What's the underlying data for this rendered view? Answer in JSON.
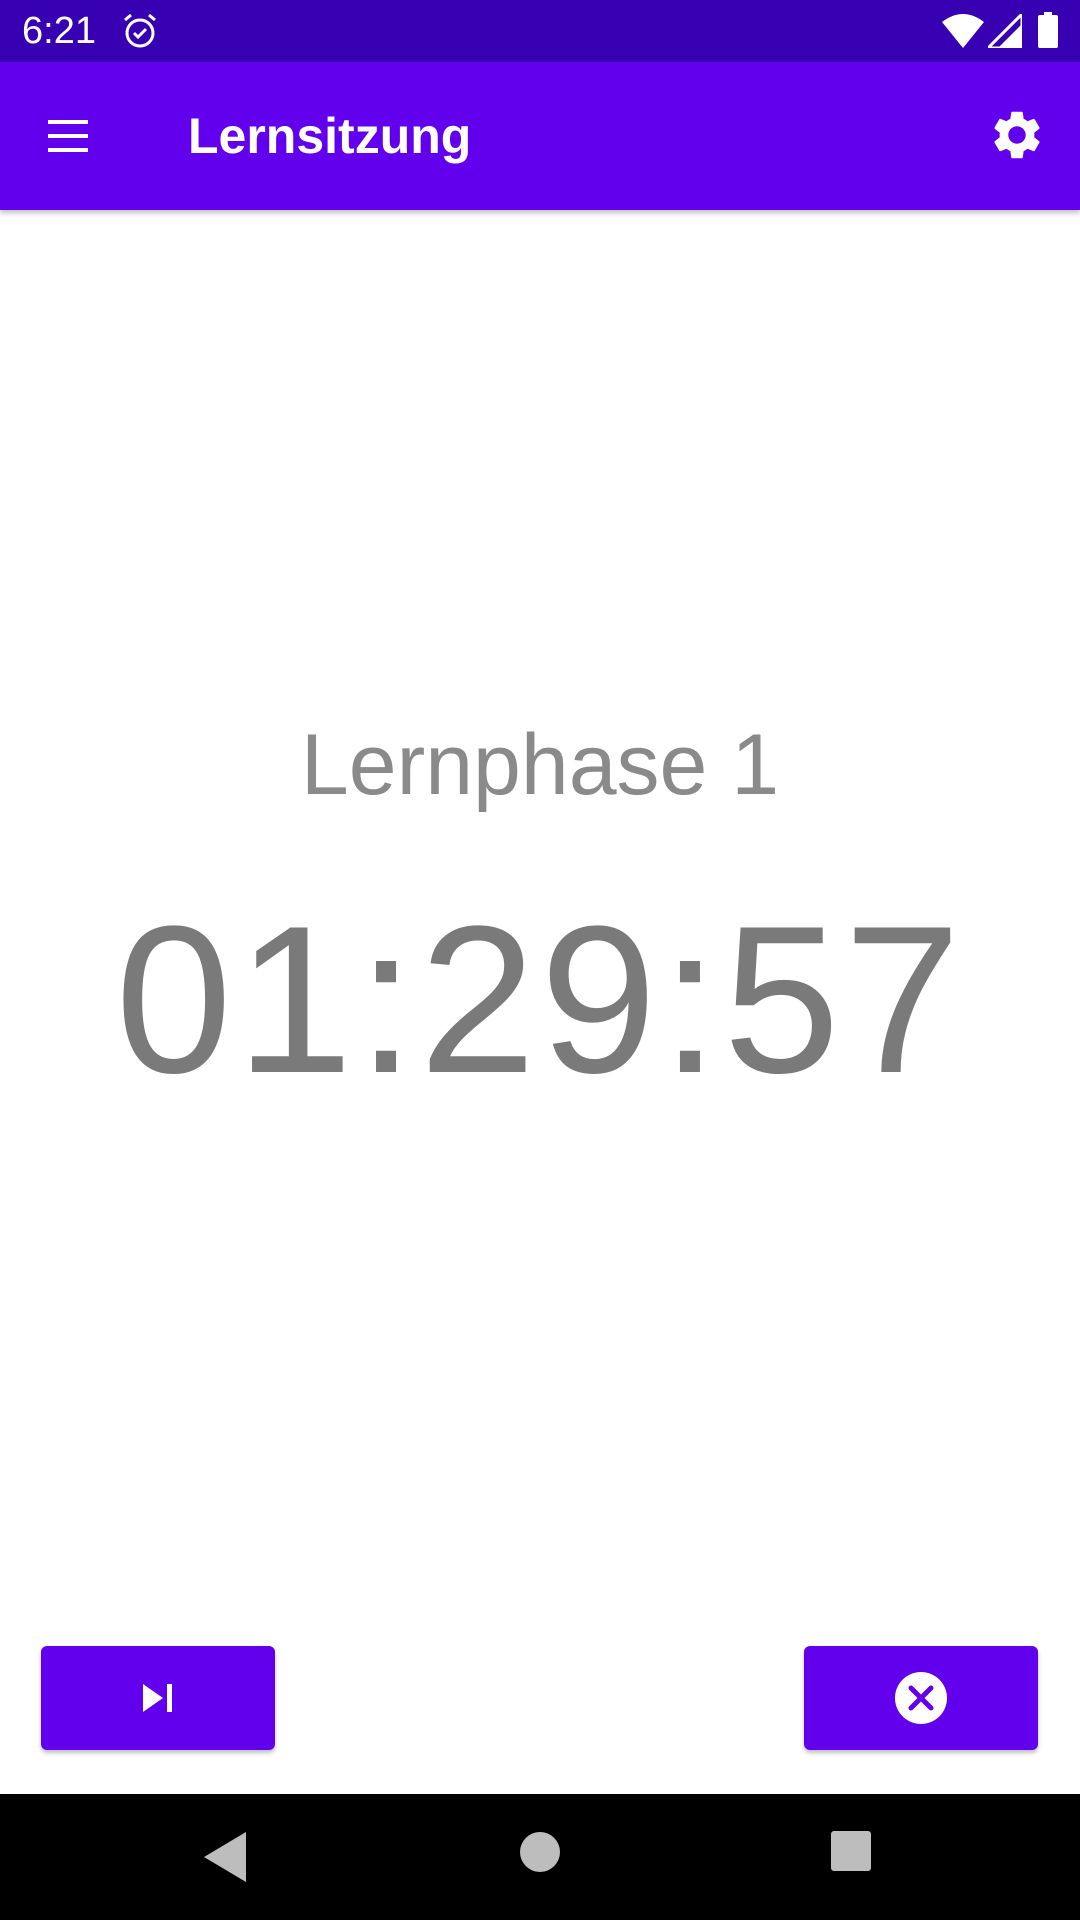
{
  "status_bar": {
    "time": "6:21",
    "icons": [
      "alarm-icon",
      "wifi-icon",
      "signal-icon",
      "battery-icon"
    ]
  },
  "app_bar": {
    "title": "Lernsitzung",
    "menu_icon": "menu-icon",
    "settings_icon": "gear-icon"
  },
  "session": {
    "phase_label": "Lernphase 1",
    "timer": "01:29:57"
  },
  "actions": {
    "skip_icon": "skip-next-icon",
    "cancel_icon": "close-circle-icon"
  },
  "nav_bar": {
    "icons": [
      "back-icon",
      "home-icon",
      "recents-icon"
    ]
  },
  "colors": {
    "status_bar": "#3700b3",
    "primary": "#6200ee",
    "text_gray": "#7a7a7a",
    "nav_bar": "#000000"
  }
}
